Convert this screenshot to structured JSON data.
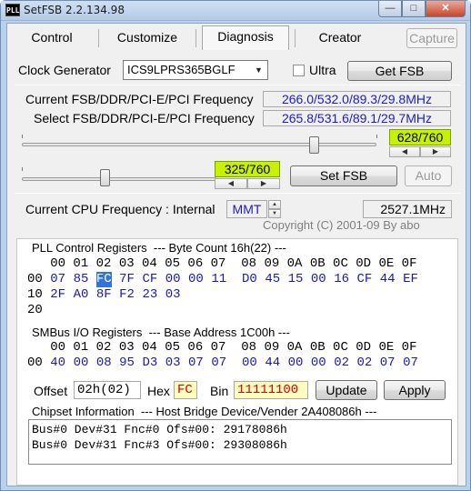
{
  "window": {
    "title": "SetFSB 2.2.134.98",
    "icon_text": "PLL",
    "min_icon": "minimize-icon",
    "max_icon": "maximize-icon",
    "close_icon": "close-icon"
  },
  "tabs": [
    {
      "label": "Control",
      "active": false
    },
    {
      "label": "Customize",
      "active": false
    },
    {
      "label": "Diagnosis",
      "active": true
    },
    {
      "label": "Creator",
      "active": false
    }
  ],
  "capture_label": "Capture",
  "clock": {
    "label": "Clock Generator",
    "selected": "ICS9LPRS365BGLF",
    "ultra_label": "Ultra",
    "ultra_checked": false,
    "get_fsb_label": "Get FSB"
  },
  "freq": {
    "current_label": "Current FSB/DDR/PCI-E/PCI Frequency",
    "current_value": "266.0/532.0/89.3/29.8MHz",
    "select_label": "Select FSB/DDR/PCI-E/PCI Frequency",
    "select_value": "265.8/531.6/89.1/29.7MHz"
  },
  "slider1": {
    "value": "628/760",
    "fraction": 0.826
  },
  "slider2": {
    "value": "325/760",
    "fraction": 0.428
  },
  "set_fsb_label": "Set FSB",
  "auto_label": "Auto",
  "cpu": {
    "label": "Current CPU Frequency : Internal",
    "mode": "MMT",
    "value": "2527.1MHz"
  },
  "copyright": "Copyright (C) 2001-09 By abo",
  "pll": {
    "title": "PLL Control Registers  --- Byte Count 16h(22) ---",
    "header": "   00 01 02 03 04 05 06 07  08 09 0A 0B 0C 0D 0E 0F",
    "rows": [
      {
        "addr": "00",
        "values": [
          "07",
          "85",
          "FC",
          "7F",
          "CF",
          "00",
          "00",
          "11",
          "D0",
          "45",
          "15",
          "00",
          "16",
          "CF",
          "44",
          "EF"
        ]
      },
      {
        "addr": "10",
        "values": [
          "2F",
          "A0",
          "8F",
          "F2",
          "23",
          "03"
        ]
      },
      {
        "addr": "20",
        "values": []
      }
    ],
    "selected_cell": "00:02"
  },
  "smbus": {
    "title": "SMBus I/O Registers  --- Base Address 1C00h ---",
    "header": "   00 01 02 03 04 05 06 07  08 09 0A 0B 0C 0D 0E 0F",
    "rows": [
      {
        "addr": "00",
        "values": [
          "40",
          "00",
          "08",
          "95",
          "D3",
          "03",
          "07",
          "07",
          "00",
          "44",
          "00",
          "00",
          "02",
          "02",
          "07",
          "07"
        ]
      }
    ]
  },
  "editor": {
    "offset_label": "Offset",
    "offset_value": "02h(02)",
    "hex_label": "Hex",
    "hex_value": "FC",
    "bin_label": "Bin",
    "bin_value": "11111100",
    "update_label": "Update",
    "apply_label": "Apply"
  },
  "chipset": {
    "title": "Chipset Information  --- Host Bridge Device/Vender 2A408086h ---",
    "lines": [
      "Bus#0 Dev#31 Fnc#0 Ofs#00: 29178086h",
      "Bus#0 Dev#31 Fnc#3 Ofs#00: 29308086h"
    ]
  }
}
